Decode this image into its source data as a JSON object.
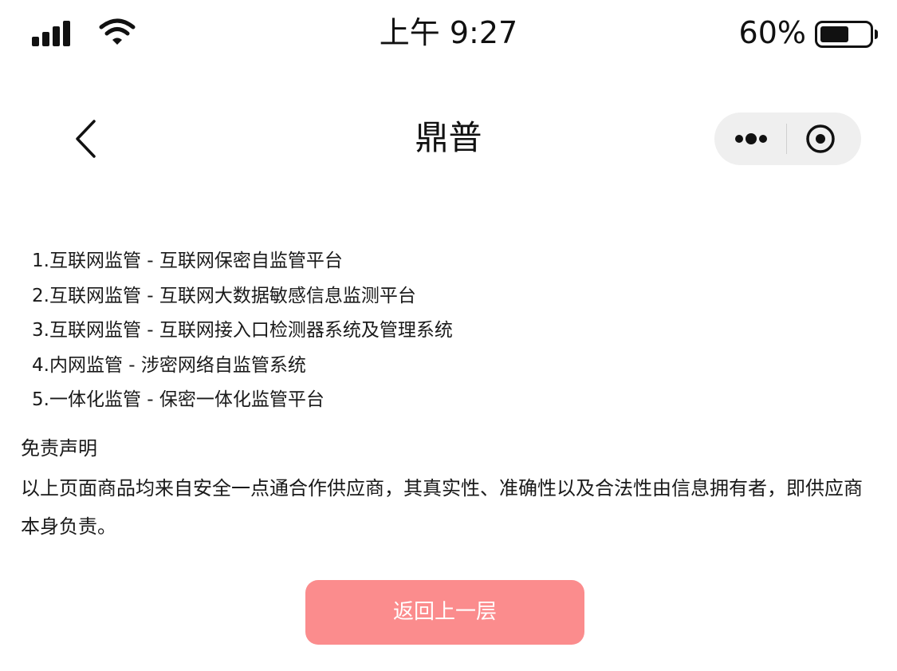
{
  "status_bar": {
    "time": "上午 9:27",
    "battery_percent": "60%",
    "battery_level": 0.6,
    "signal_icon": "cellular-signal-icon",
    "wifi_icon": "wifi-icon"
  },
  "nav": {
    "title": "鼎普",
    "back_icon": "chevron-left-icon",
    "more_icon": "more-dots-icon",
    "close_icon": "target-circle-icon"
  },
  "content": {
    "items": [
      "1.互联网监管 - 互联网保密自监管平台",
      "2.互联网监管 - 互联网大数据敏感信息监测平台",
      "3.互联网监管 - 互联网接入口检测器系统及管理系统",
      "4.内网监管 - 涉密网络自监管系统",
      "5.一体化监管 - 保密一体化监管平台"
    ],
    "disclaimer_title": "免责声明",
    "disclaimer_body": "以上页面商品均来自安全一点通合作供应商，其真实性、准确性以及合法性由信息拥有者，即供应商本身负责。"
  },
  "actions": {
    "back_label": "返回上一层"
  },
  "colors": {
    "button_bg": "#fb8c8d",
    "capsule_bg": "#efefef",
    "text": "#1a1a1a"
  }
}
